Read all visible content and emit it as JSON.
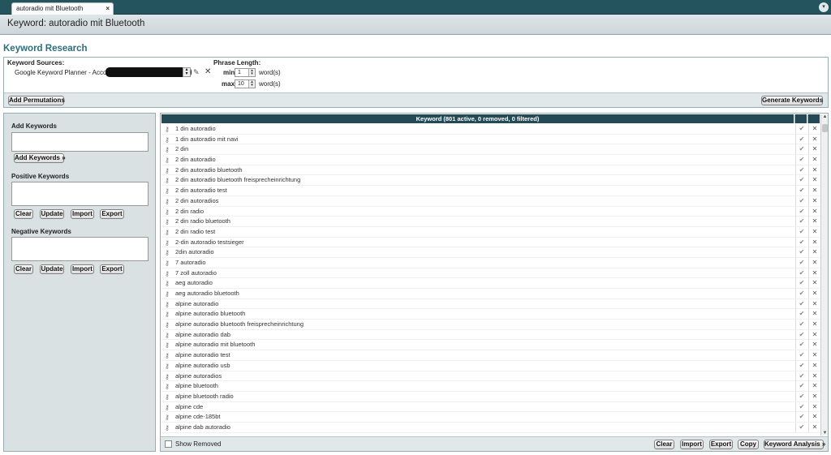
{
  "tab": {
    "title": "autoradio mit Bluetooth",
    "close": "×"
  },
  "menu_button": "▾",
  "keyword_bar": {
    "title": "Keyword: autoradio mit Bluetooth"
  },
  "page": {
    "title": "Keyword Research"
  },
  "sources": {
    "label": "Keyword Sources:",
    "item": "Google Keyword Planner - Account:",
    "phrase_length_label": "Phrase Length:",
    "min_label": "min:",
    "min_value": "1",
    "max_label": "max:",
    "max_value": "10",
    "unit": "word(s)",
    "add_permutations": "Add Permutations",
    "generate_keywords": "Generate Keywords"
  },
  "left_panel": {
    "add_keywords_title": "Add Keywords",
    "add_keywords_button": "Add Keywords »",
    "positive_title": "Positive Keywords",
    "negative_title": "Negative Keywords",
    "clear": "Clear",
    "update": "Update",
    "import": "Import",
    "export": "Export"
  },
  "grid": {
    "header": "Keyword (801 active, 0 removed, 0 filtered)",
    "show_removed": "Show Removed",
    "buttons": {
      "clear": "Clear",
      "import": "Import",
      "export": "Export",
      "copy": "Copy",
      "analysis": "Keyword Analysis »"
    },
    "rows": [
      "1 din autoradio",
      "1 din autoradio mit navi",
      "2 din",
      "2 din autoradio",
      "2 din autoradio bluetooth",
      "2 din autoradio bluetooth freisprecheinrichtung",
      "2 din autoradio test",
      "2 din autoradios",
      "2 din radio",
      "2 din radio bluetooth",
      "2 din radio test",
      "2-din autoradio testsieger",
      "2din autoradio",
      "7 autoradio",
      "7 zoll autoradio",
      "aeg autoradio",
      "aeg autoradio bluetooth",
      "alpine autoradio",
      "alpine autoradio bluetooth",
      "alpine autoradio bluetooth freisprecheinrichtung",
      "alpine autoradio dab",
      "alpine autoradio mit bluetooth",
      "alpine autoradio test",
      "alpine autoradio usb",
      "alpine autoradios",
      "alpine bluetooth",
      "alpine bluetooth radio",
      "alpine cde",
      "alpine cde-185bt",
      "alpine dab autoradio"
    ]
  },
  "icons": {
    "keyword": "key-icon",
    "accept": "check-icon",
    "remove": "remove-icon",
    "edit": "pencil-icon",
    "delete": "close-icon"
  },
  "colors": {
    "tabstrip": "#24545e",
    "header": "#234a55",
    "title": "#2a6f7a"
  }
}
